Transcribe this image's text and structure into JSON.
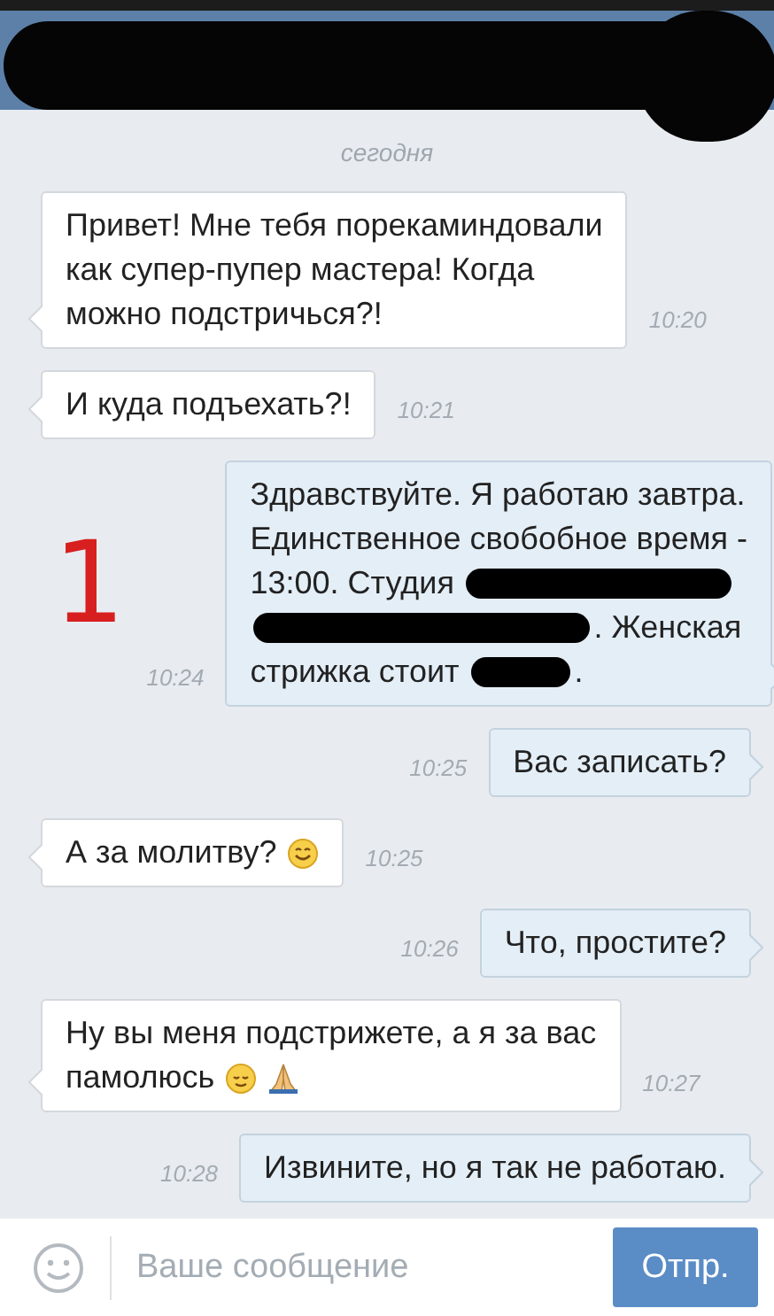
{
  "header": {
    "redacted": true
  },
  "date_label": "сегодня",
  "messages": [
    {
      "kind": "incoming",
      "time": "10:20",
      "lines": [
        [
          {
            "kind": "text",
            "text": "Привет! Мне тебя порекаминдовали"
          }
        ],
        [
          {
            "kind": "text",
            "text": "как супер-пупер мастера! Когда"
          }
        ],
        [
          {
            "kind": "text",
            "text": "можно подстричься?!"
          }
        ]
      ]
    },
    {
      "kind": "incoming",
      "time": "10:21",
      "lines": [
        [
          {
            "kind": "text",
            "text": "И куда подъехать?!"
          }
        ]
      ]
    },
    {
      "kind": "outgoing",
      "time": "10:24",
      "annotation": "1",
      "lines": [
        [
          {
            "kind": "text",
            "text": "Здравствуйте. Я работаю завтра."
          }
        ],
        [
          {
            "kind": "text",
            "text": "Единственное свобобное время -"
          }
        ],
        [
          {
            "kind": "text",
            "text": "13:00. Студия"
          },
          {
            "kind": "redaction"
          }
        ],
        [
          {
            "kind": "redaction"
          },
          {
            "kind": "text",
            "text": ". Женская"
          }
        ],
        [
          {
            "kind": "text",
            "text": "стрижка стоит"
          },
          {
            "kind": "redaction"
          },
          {
            "kind": "text",
            "text": "."
          }
        ]
      ]
    },
    {
      "kind": "outgoing",
      "time": "10:25",
      "lines": [
        [
          {
            "kind": "text",
            "text": "Вас записать?"
          }
        ]
      ]
    },
    {
      "kind": "incoming",
      "time": "10:25",
      "lines": [
        [
          {
            "kind": "text",
            "text": "А за молитву?"
          },
          {
            "kind": "smile"
          }
        ]
      ]
    },
    {
      "kind": "outgoing",
      "time": "10:26",
      "lines": [
        [
          {
            "kind": "text",
            "text": "Что, простите?"
          }
        ]
      ]
    },
    {
      "kind": "incoming",
      "time": "10:27",
      "lines": [
        [
          {
            "kind": "text",
            "text": "Ну вы меня подстрижете, а я за вас"
          }
        ],
        [
          {
            "kind": "text",
            "text": "памолюсь"
          },
          {
            "kind": "relieved"
          },
          {
            "kind": "pray"
          }
        ]
      ]
    },
    {
      "kind": "outgoing",
      "time": "10:28",
      "lines": [
        [
          {
            "kind": "text",
            "text": "Извините, но я так не работаю."
          }
        ]
      ]
    }
  ],
  "composer": {
    "placeholder": "Ваше сообщение",
    "send_label": "Отпр."
  }
}
